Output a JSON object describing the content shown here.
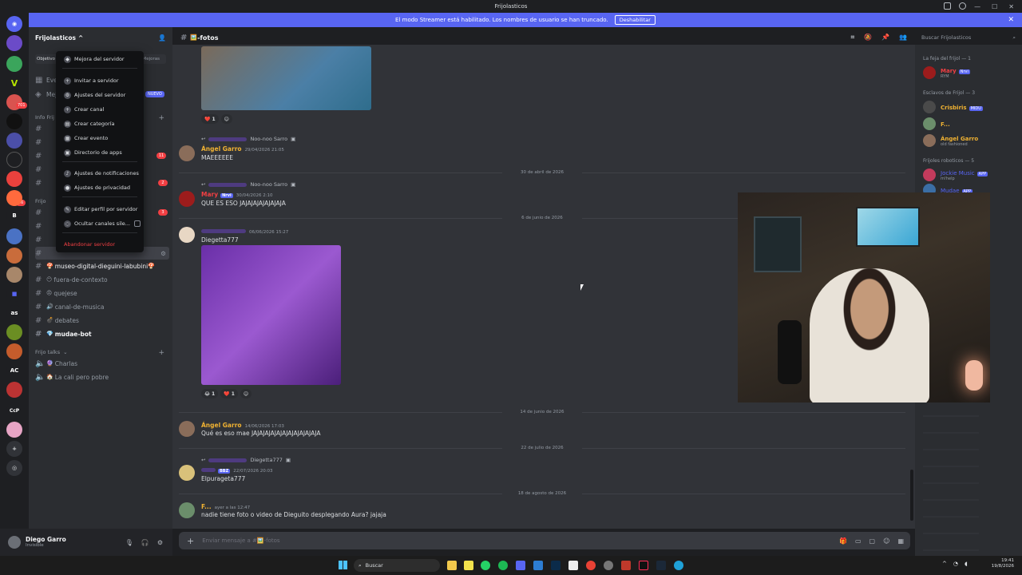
{
  "window": {
    "title": "Frijolasticos"
  },
  "banner": {
    "text": "El modo Streamer está habilitado. Los nombres de usuario se han truncado.",
    "button": "Deshabilitar",
    "close": "✕"
  },
  "guilds": {
    "badges": [
      "701",
      "11",
      "6",
      "46"
    ],
    "letters": [
      "V",
      "B",
      "as",
      "AC",
      "CcP"
    ]
  },
  "server": {
    "name": "Frijolasticos",
    "chevron": "^"
  },
  "sidebar": {
    "top_label": "Objetivo d",
    "top_label_right": "Mejoras",
    "events_label": "Eve",
    "nuevo_badge": "NUEVO",
    "mejoras_label": "Mej",
    "info_label": "Info Frij",
    "frijo_label": "Frijo",
    "badge_11": "11",
    "badge_2": "2",
    "badge_3": "3",
    "channels": [
      {
        "name": "museo-digital-dieguini-labubini",
        "emoji": "🍄",
        "bright": true
      },
      {
        "name": "fuera-de-contexto",
        "emoji": "😶",
        "bright": false
      },
      {
        "name": "quejese",
        "emoji": "😠",
        "bright": false
      },
      {
        "name": "canal-de-musica",
        "emoji": "🔊",
        "bright": false
      },
      {
        "name": "debates",
        "emoji": "💣",
        "bright": false
      },
      {
        "name": "mudae-bot",
        "emoji": "💎",
        "bright": true
      }
    ],
    "talks_category": "Frijo talks",
    "voice": [
      {
        "name": "Charlas",
        "emoji": "🔮"
      },
      {
        "name": "La cali pero pobre",
        "emoji": "🏠"
      }
    ]
  },
  "context_menu": {
    "items": [
      {
        "label": "Mejora del servidor",
        "icon": "boost-icon",
        "red": false
      },
      {
        "label": "Invitar a servidor",
        "icon": "invite-icon",
        "red": false
      },
      {
        "label": "Ajustes del servidor",
        "icon": "gear-icon",
        "red": false
      },
      {
        "label": "Crear canal",
        "icon": "plus-circle-icon",
        "red": false
      },
      {
        "label": "Crear categoría",
        "icon": "folder-icon",
        "red": false
      },
      {
        "label": "Crear evento",
        "icon": "calendar-icon",
        "red": false
      },
      {
        "label": "Directorio de apps",
        "icon": "apps-icon",
        "red": false
      },
      {
        "label": "Ajustes de notificaciones",
        "icon": "bell-icon",
        "red": false
      },
      {
        "label": "Ajustes de privacidad",
        "icon": "shield-icon",
        "red": false
      },
      {
        "label": "Editar perfil por servidor",
        "icon": "pencil-icon",
        "red": false
      },
      {
        "label": "Ocultar canales sile...",
        "icon": "eye-icon",
        "red": false
      },
      {
        "label": "Abandonar servidor",
        "icon": "exit-icon",
        "red": true
      }
    ]
  },
  "user": {
    "name": "Diego Garro",
    "status": "Invisible"
  },
  "channel": {
    "name": "-fotos",
    "emoji": "🖼️"
  },
  "chat": {
    "messages": [
      {
        "reply_to": "Noo-noo Sarro",
        "author": "Ángel Garro",
        "time": "29/04/2026 21:05",
        "text": "MAEEEEEE",
        "color": "#f0b232"
      },
      {
        "reply_to": "Noo-noo Sarro",
        "author": "Mary",
        "author_tag": "Nrvi",
        "time": "30/04/2026 2:10",
        "text": "QUE ES ESO JAJAJAJAJAJAJAJA",
        "color": "#f23f43"
      },
      {
        "reply_to": "",
        "author": "",
        "time": "06/06/2026 15:27",
        "text": "Diegetta777",
        "color": "#dbdee1"
      },
      {
        "reply_to": "",
        "author": "Ángel Garro",
        "time": "14/06/2026 17:03",
        "text": "Qué es eso mae JAJAJAJAJAJAJAJAJAJAJAJA",
        "color": "#f0b232"
      },
      {
        "reply_to": "Diegetta777",
        "author": "",
        "author_tag": "BBZ",
        "time": "22/07/2026 20:03",
        "text": "Elpurageta777",
        "color": "#dbdee1"
      },
      {
        "reply_to": "",
        "author": "F...",
        "time": "ayer a las 12:47",
        "text": "nadie tiene foto o video de Dieguito desplegando Aura? jajaja",
        "color": "#f0b232"
      }
    ],
    "dates": [
      "30 de abril de 2026",
      "6 de junio de 2026",
      "14 de junio de 2026",
      "22 de julio de 2026",
      "18 de agosto de 2026"
    ],
    "reactions1": [
      {
        "emoji": "❤️",
        "count": "1"
      }
    ],
    "reactions2": [
      {
        "emoji": "😂",
        "count": "1"
      },
      {
        "emoji": "❤️",
        "count": "1"
      }
    ]
  },
  "composer": {
    "placeholder": "Enviar mensaje a #🖼️-fotos"
  },
  "members": {
    "search_placeholder": "Buscar Frijolasticos",
    "groups": [
      {
        "label": "La feja del frijol — 1"
      },
      {
        "label": "Esclavos de Frijol — 3"
      },
      {
        "label": "Frijoles roboticos — 5"
      }
    ],
    "list": [
      {
        "name": "Mary",
        "tag": "Nrvi",
        "sub": "RYM",
        "color": "#f23f43"
      },
      {
        "name": "Crisbiris",
        "tag": "MIDU",
        "sub": "",
        "color": "#f0b232"
      },
      {
        "name": "F...",
        "tag": "",
        "sub": "",
        "color": "#f0b232"
      },
      {
        "name": "Ángel Garro",
        "tag": "",
        "sub": "old fashioned",
        "color": "#f0b232"
      },
      {
        "name": "Jockie Music",
        "tag": "APP",
        "sub": "m!help",
        "color": "#5865f2"
      },
      {
        "name": "Mudae",
        "tag": "APP",
        "sub": "",
        "color": "#5865f2"
      }
    ]
  },
  "taskbar": {
    "search": "Buscar",
    "time": "19:41",
    "date": "19/8/2026"
  }
}
